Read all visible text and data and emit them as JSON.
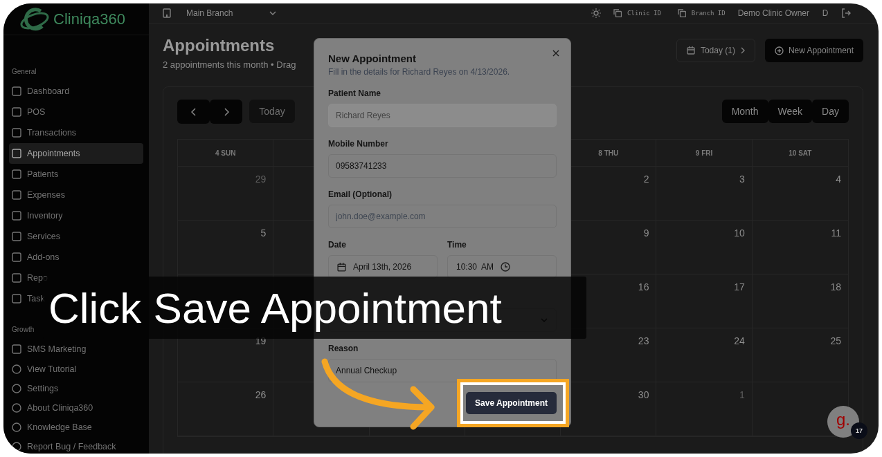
{
  "sidebar": {
    "logo": "Cliniqa360",
    "sections": [
      {
        "title": "General",
        "items": [
          {
            "label": "Dashboard",
            "selected": false
          },
          {
            "label": "POS",
            "selected": false
          },
          {
            "label": "Transactions",
            "selected": false
          },
          {
            "label": "Appointments",
            "selected": true
          },
          {
            "label": "Patients",
            "selected": false
          },
          {
            "label": "Expenses",
            "selected": false
          },
          {
            "label": "Inventory",
            "selected": false
          },
          {
            "label": "Services",
            "selected": false
          },
          {
            "label": "Add-ons",
            "selected": false
          },
          {
            "label": "Repo",
            "selected": false
          },
          {
            "label": "Task",
            "selected": false
          }
        ]
      },
      {
        "title": "Growth",
        "items": [
          {
            "label": "SMS Marketing",
            "selected": false
          }
        ]
      }
    ],
    "footer_items": [
      "View Tutorial",
      "Settings",
      "About Cliniqa360",
      "Knowledge Base",
      "Report Bug / Feedback"
    ]
  },
  "topbar": {
    "branch": "Main Branch",
    "clinic_id": "Clinic ID",
    "branch_id": "Branch ID",
    "user": "Demo Clinic Owner",
    "avatar": "D"
  },
  "header": {
    "title": "Appointments",
    "subtitle": "2 appointments this month • Drag",
    "today_button": "Today (1)",
    "new_button": "New Appointment"
  },
  "calendar": {
    "today": "Today",
    "views": [
      "Month",
      "Week",
      "Day"
    ],
    "headers": {
      "sun": "4 SUN",
      "thu": "8 THU",
      "fri": "9 FRI",
      "sat": "10 SAT"
    },
    "weeks": [
      {
        "sun": {
          "n": "29",
          "muted": true
        },
        "thu": {
          "n": "2",
          "muted": false
        },
        "fri": {
          "n": "3",
          "muted": false
        },
        "sat": {
          "n": "4",
          "muted": false
        }
      },
      {
        "sun": {
          "n": "5",
          "muted": false
        },
        "thu": {
          "n": "9",
          "muted": false
        },
        "fri": {
          "n": "10",
          "muted": false
        },
        "sat": {
          "n": "11",
          "muted": false
        }
      },
      {
        "thu": {
          "n": "16",
          "muted": false
        },
        "fri": {
          "n": "17",
          "muted": false
        },
        "sat": {
          "n": "18",
          "muted": false
        }
      },
      {
        "sun": {
          "n": "19",
          "muted": false
        },
        "thu": {
          "n": "23",
          "muted": false
        },
        "fri": {
          "n": "24",
          "muted": false
        },
        "sat": {
          "n": "25",
          "muted": false
        }
      },
      {
        "sun": {
          "n": "26",
          "muted": false
        },
        "thu": {
          "n": "30",
          "muted": false
        },
        "fri": {
          "n": "1",
          "muted": true
        }
      }
    ]
  },
  "modal": {
    "title": "New Appointment",
    "subtitle": "Fill in the details for Richard Reyes on 4/13/2026.",
    "fields": [
      {
        "label": "Patient Name",
        "value": "Richard Reyes",
        "disabled": true
      },
      {
        "label": "Mobile Number",
        "value": "09583741233",
        "disabled": false
      },
      {
        "label": "Email (Optional)",
        "placeholder": "john.doe@example.com",
        "disabled": false
      }
    ],
    "date_time": [
      {
        "kind": "date",
        "label": "Date",
        "value": "April 13th, 2026"
      },
      {
        "kind": "time",
        "label": "Time",
        "value": "10:30  AM"
      }
    ],
    "reason": {
      "label": "Reason",
      "value": "Annual Checkup"
    },
    "save_button": "Save Appointment"
  },
  "tutorial": {
    "caption": "Click Save Appointment"
  },
  "widget": {
    "logo": "g.",
    "badge": "17"
  }
}
